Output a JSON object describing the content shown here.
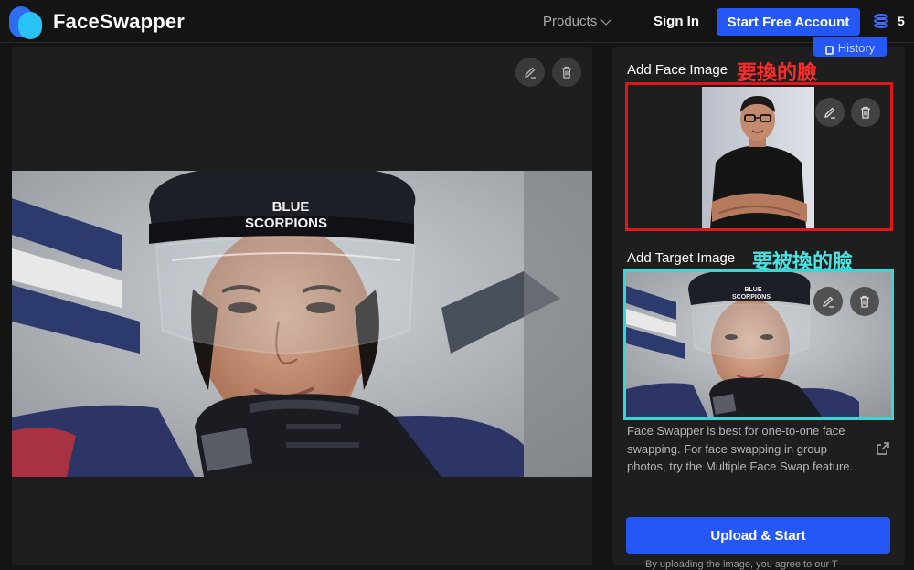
{
  "header": {
    "brand": "FaceSwapper",
    "products_label": "Products",
    "signin_label": "Sign In",
    "start_label": "Start Free Account",
    "credits": "5"
  },
  "panel": {
    "history_label": "History",
    "face_label": "Add Face Image",
    "face_annotation": "要換的臉",
    "target_label": "Add Target Image",
    "target_annotation": "要被換的臉",
    "info_text": "Face Swapper is best for one-to-one face swapping. For face swapping in group photos, try the Multiple Face Swap feature.",
    "upload_label": "Upload & Start",
    "footer_text": "By uploading the image, you agree to our T"
  },
  "preview_image": {
    "helmet_line1": "BLUE",
    "helmet_line2": "SCORPIONS"
  },
  "target_thumb": {
    "helmet_line1": "BLUE",
    "helmet_line2": "SCORPIONS"
  },
  "colors": {
    "accent": "#2457f5",
    "face_border": "#e3151c",
    "target_border": "#3fd4d4"
  }
}
